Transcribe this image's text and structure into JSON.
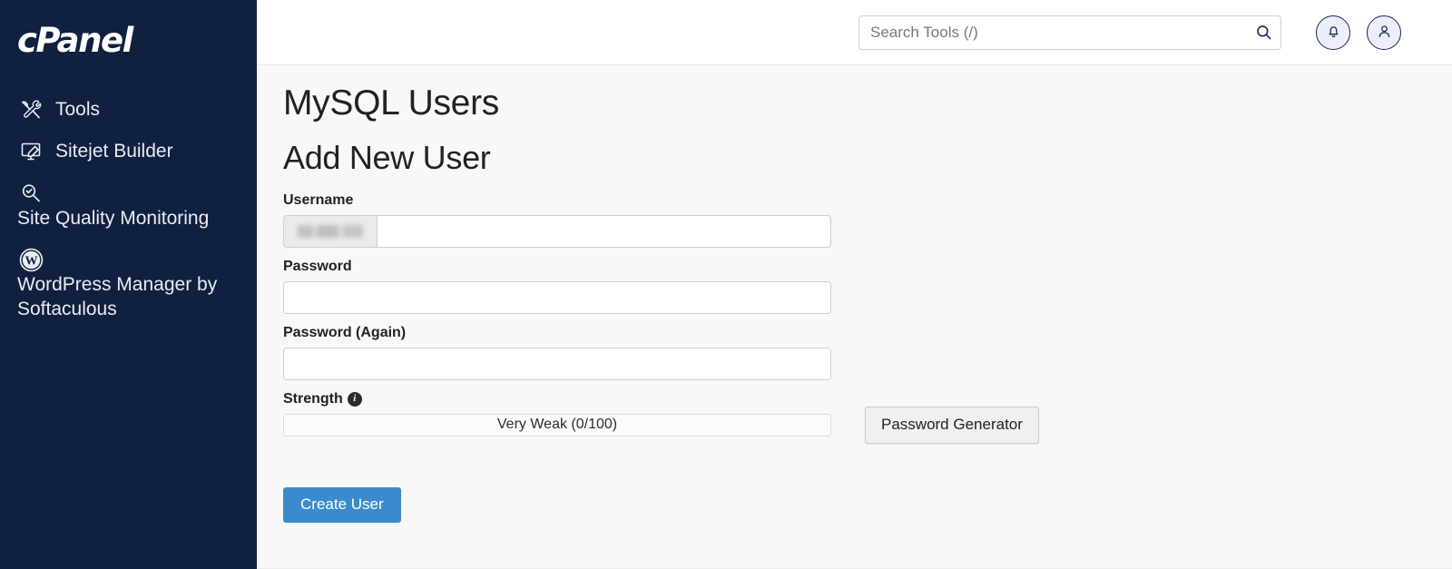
{
  "sidebar": {
    "logo_text": "cPanel",
    "bg_color": "#10203f",
    "items": [
      {
        "label": "Tools",
        "icon": "tools-icon"
      },
      {
        "label": "Sitejet Builder",
        "icon": "sitejet-builder-icon"
      },
      {
        "label": "Site Quality Monitoring",
        "icon": "site-quality-monitoring-icon"
      },
      {
        "label": "WordPress Manager by Softaculous",
        "icon": "wordpress-icon"
      }
    ]
  },
  "topbar": {
    "search": {
      "placeholder": "Search Tools (/)",
      "value": "",
      "icon": "search-icon"
    },
    "notifications_icon": "bell-icon",
    "account_icon": "user-icon"
  },
  "main": {
    "page_title": "MySQL Users",
    "section_title": "Add New User",
    "fields": {
      "username": {
        "label": "Username",
        "prefix_redacted": true,
        "value": "",
        "placeholder": ""
      },
      "password": {
        "label": "Password",
        "value": "",
        "placeholder": ""
      },
      "password_again": {
        "label": "Password (Again)",
        "value": "",
        "placeholder": ""
      }
    },
    "strength": {
      "label": "Strength",
      "info_icon": "info-icon",
      "info_glyph": "i",
      "value_text": "Very Weak (0/100)",
      "score": 0,
      "max_score": 100,
      "rating": "Very Weak"
    },
    "buttons": {
      "password_generator": "Password Generator",
      "create_user": "Create User",
      "create_user_color": "#3a8bcd"
    }
  }
}
